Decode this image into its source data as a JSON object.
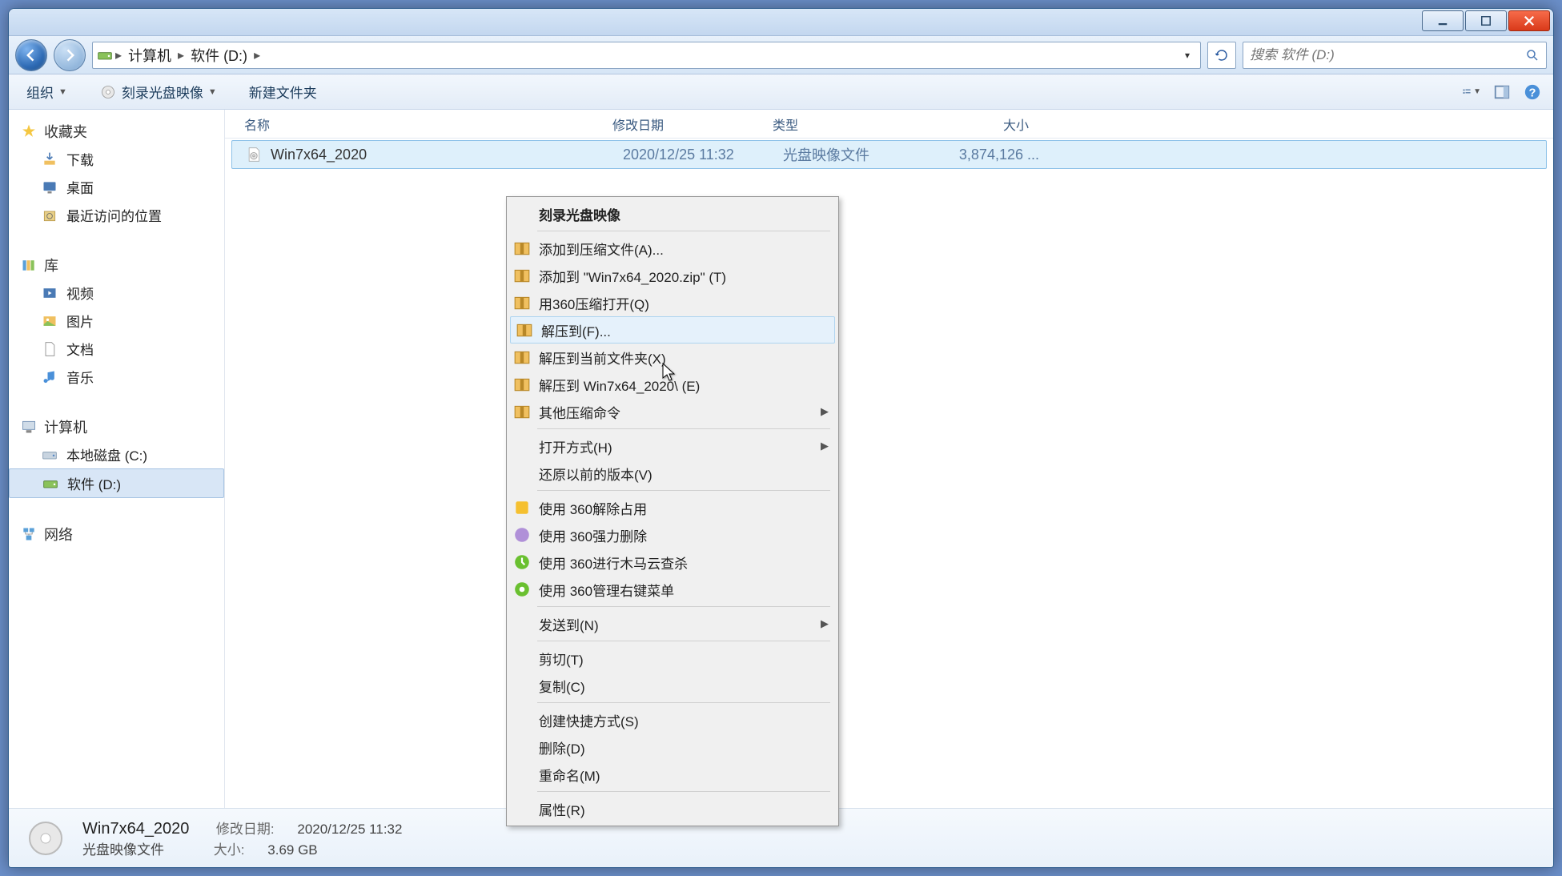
{
  "titlebar": {
    "min": "_",
    "max": "◻",
    "close": "×"
  },
  "breadcrumb": {
    "computer": "计算机",
    "drive": "软件 (D:)"
  },
  "search": {
    "placeholder": "搜索 软件 (D:)"
  },
  "toolbar": {
    "organize": "组织",
    "burn": "刻录光盘映像",
    "newfolder": "新建文件夹"
  },
  "columns": {
    "name": "名称",
    "date": "修改日期",
    "type": "类型",
    "size": "大小"
  },
  "sidebar": {
    "fav": "收藏夹",
    "favs": [
      "下载",
      "桌面",
      "最近访问的位置"
    ],
    "lib": "库",
    "libs": [
      "视频",
      "图片",
      "文档",
      "音乐"
    ],
    "comp": "计算机",
    "drives": [
      "本地磁盘 (C:)",
      "软件 (D:)"
    ],
    "net": "网络"
  },
  "file": {
    "name": "Win7x64_2020",
    "date": "2020/12/25 11:32",
    "type": "光盘映像文件",
    "size": "3,874,126 ..."
  },
  "status": {
    "title": "Win7x64_2020",
    "type": "光盘映像文件",
    "datelbl": "修改日期:",
    "date": "2020/12/25 11:32",
    "sizelbl": "大小:",
    "size": "3.69 GB"
  },
  "ctx": {
    "burn": "刻录光盘映像",
    "addarc": "添加到压缩文件(A)...",
    "addzip": "添加到 \"Win7x64_2020.zip\" (T)",
    "open360": "用360压缩打开(Q)",
    "extract": "解压到(F)...",
    "extracthere": "解压到当前文件夹(X)",
    "extractdir": "解压到 Win7x64_2020\\ (E)",
    "othercomp": "其他压缩命令",
    "openwith": "打开方式(H)",
    "restore": "还原以前的版本(V)",
    "unlock360": "使用 360解除占用",
    "force360": "使用 360强力删除",
    "scan360": "使用 360进行木马云查杀",
    "menu360": "使用 360管理右键菜单",
    "sendto": "发送到(N)",
    "cut": "剪切(T)",
    "copy": "复制(C)",
    "shortcut": "创建快捷方式(S)",
    "delete": "删除(D)",
    "rename": "重命名(M)",
    "props": "属性(R)"
  }
}
